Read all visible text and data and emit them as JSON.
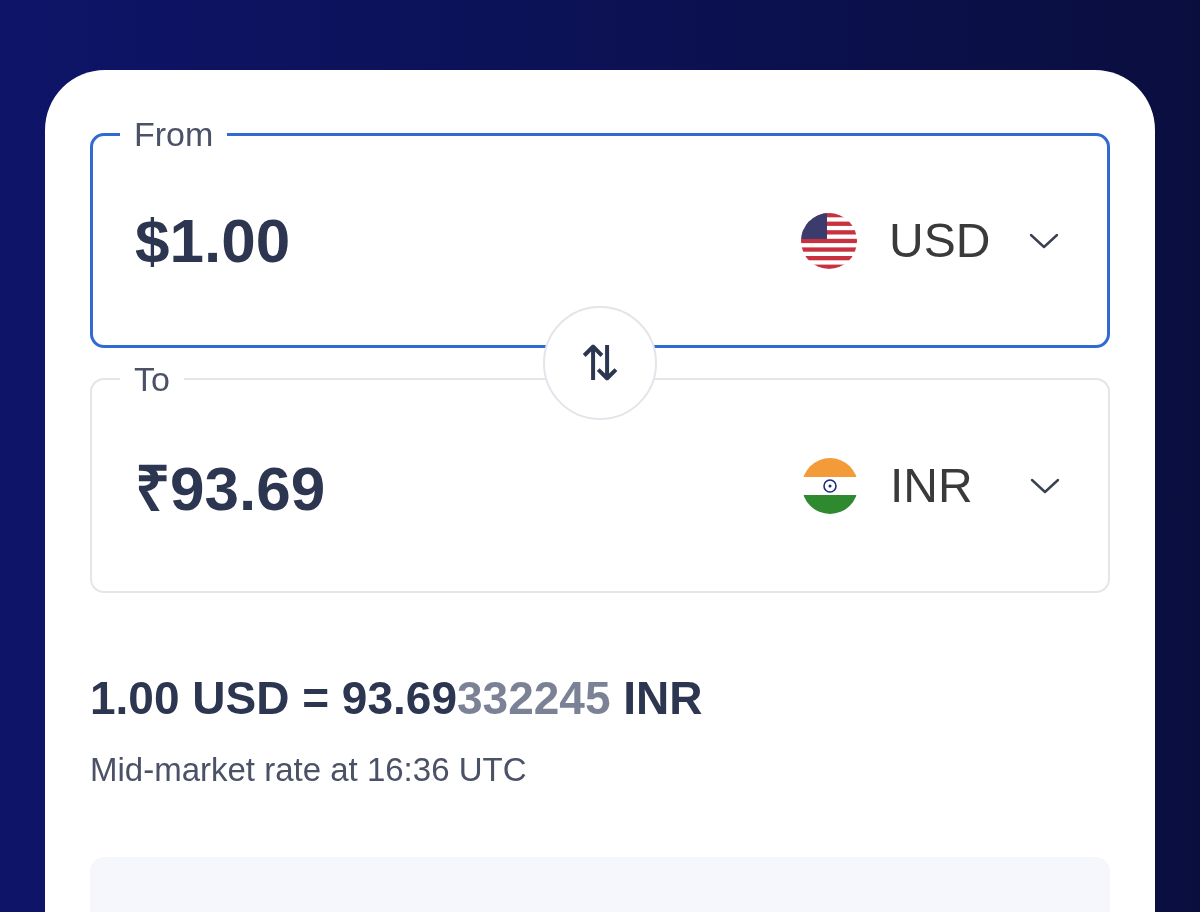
{
  "fields": [
    {
      "label": "From",
      "amount": "$1.00",
      "currency": "USD",
      "kind": "us",
      "focused": true
    },
    {
      "label": "To",
      "amount": "₹93.69",
      "currency": "INR",
      "kind": "in",
      "focused": false
    }
  ],
  "swap": {
    "icon": "⇅"
  },
  "rate": {
    "main": "1.00 USD = 93.69",
    "extra_digits": "332245",
    "unit": "INR"
  },
  "rate_note": "Mid-market rate at 16:36 UTC"
}
